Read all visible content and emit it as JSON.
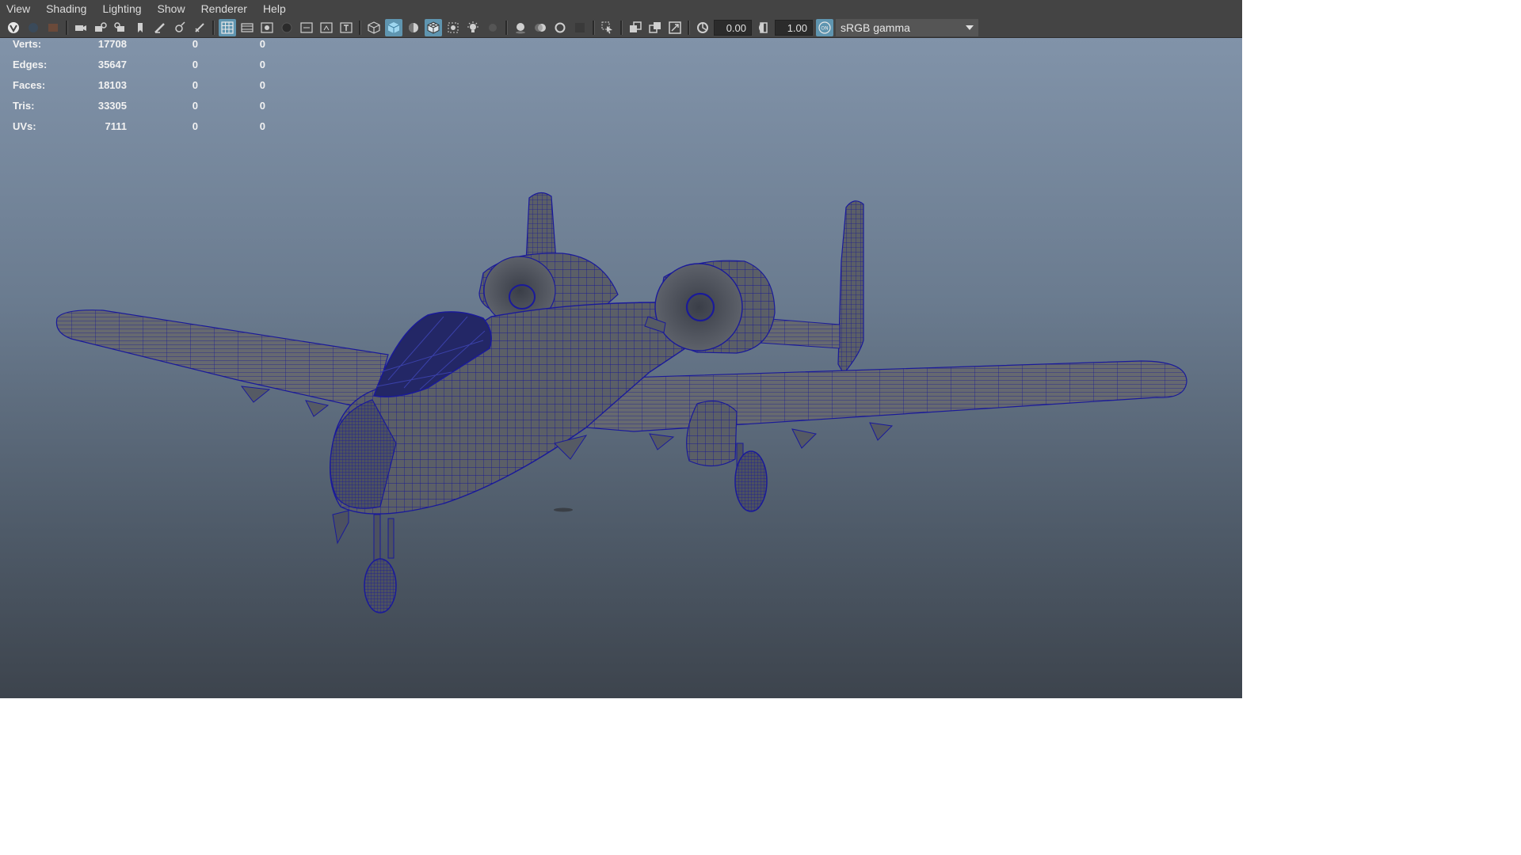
{
  "menubar": {
    "items": [
      "View",
      "Shading",
      "Lighting",
      "Show",
      "Renderer",
      "Help"
    ]
  },
  "toolbar": {
    "exposure_value": "0.00",
    "gamma_value": "1.00",
    "colorspace_value": "sRGB gamma",
    "icons": [
      "select-camera-icon",
      "lock-camera-icon",
      "camera-attributes-icon",
      "camera-icon",
      "bookmark-camera-icon",
      "previous-view-icon",
      "next-view-icon",
      "bookmark-icon",
      "grease-pencil-icon",
      "2d-pan-zoom-icon",
      "image-plane-icon",
      "grid-icon",
      "film-gate-icon",
      "resolution-gate-icon",
      "gate-mask-icon",
      "field-chart-icon",
      "safe-action-icon",
      "safe-title-icon",
      "wireframe-icon",
      "smooth-shade-all-icon",
      "default-material-icon",
      "wireframe-on-shaded-icon",
      "xray-icon",
      "use-all-lights-icon",
      "shadows-icon",
      "screen-space-ambient-occlusion-icon",
      "motion-blur-icon",
      "multisample-antialiasing-icon",
      "depth-of-field-icon",
      "isolate-select-icon",
      "xray-joints-icon",
      "xray-active-components-icon",
      "backface-culling-icon",
      "exposure-icon",
      "gamma-icon",
      "color-management-icon",
      "dropdown-arrow-icon"
    ],
    "colors": {
      "bar_bg": "#444444",
      "active_btn": "#5f95b0",
      "icon": "#cfcfcf"
    }
  },
  "hud": {
    "rows": [
      {
        "label": "Verts:",
        "v1": "17708",
        "v2": "0",
        "v3": "0"
      },
      {
        "label": "Edges:",
        "v1": "35647",
        "v2": "0",
        "v3": "0"
      },
      {
        "label": "Faces:",
        "v1": "18103",
        "v2": "0",
        "v3": "0"
      },
      {
        "label": "Tris:",
        "v1": "33305",
        "v2": "0",
        "v3": "0"
      },
      {
        "label": "UVs:",
        "v1": "7111",
        "v2": "0",
        "v3": "0"
      }
    ]
  },
  "viewport": {
    "background_top": "#8193a9",
    "background_bottom": "#3d444d",
    "model_surface": "#5d6169",
    "wire_color": "#1a1a9a"
  }
}
